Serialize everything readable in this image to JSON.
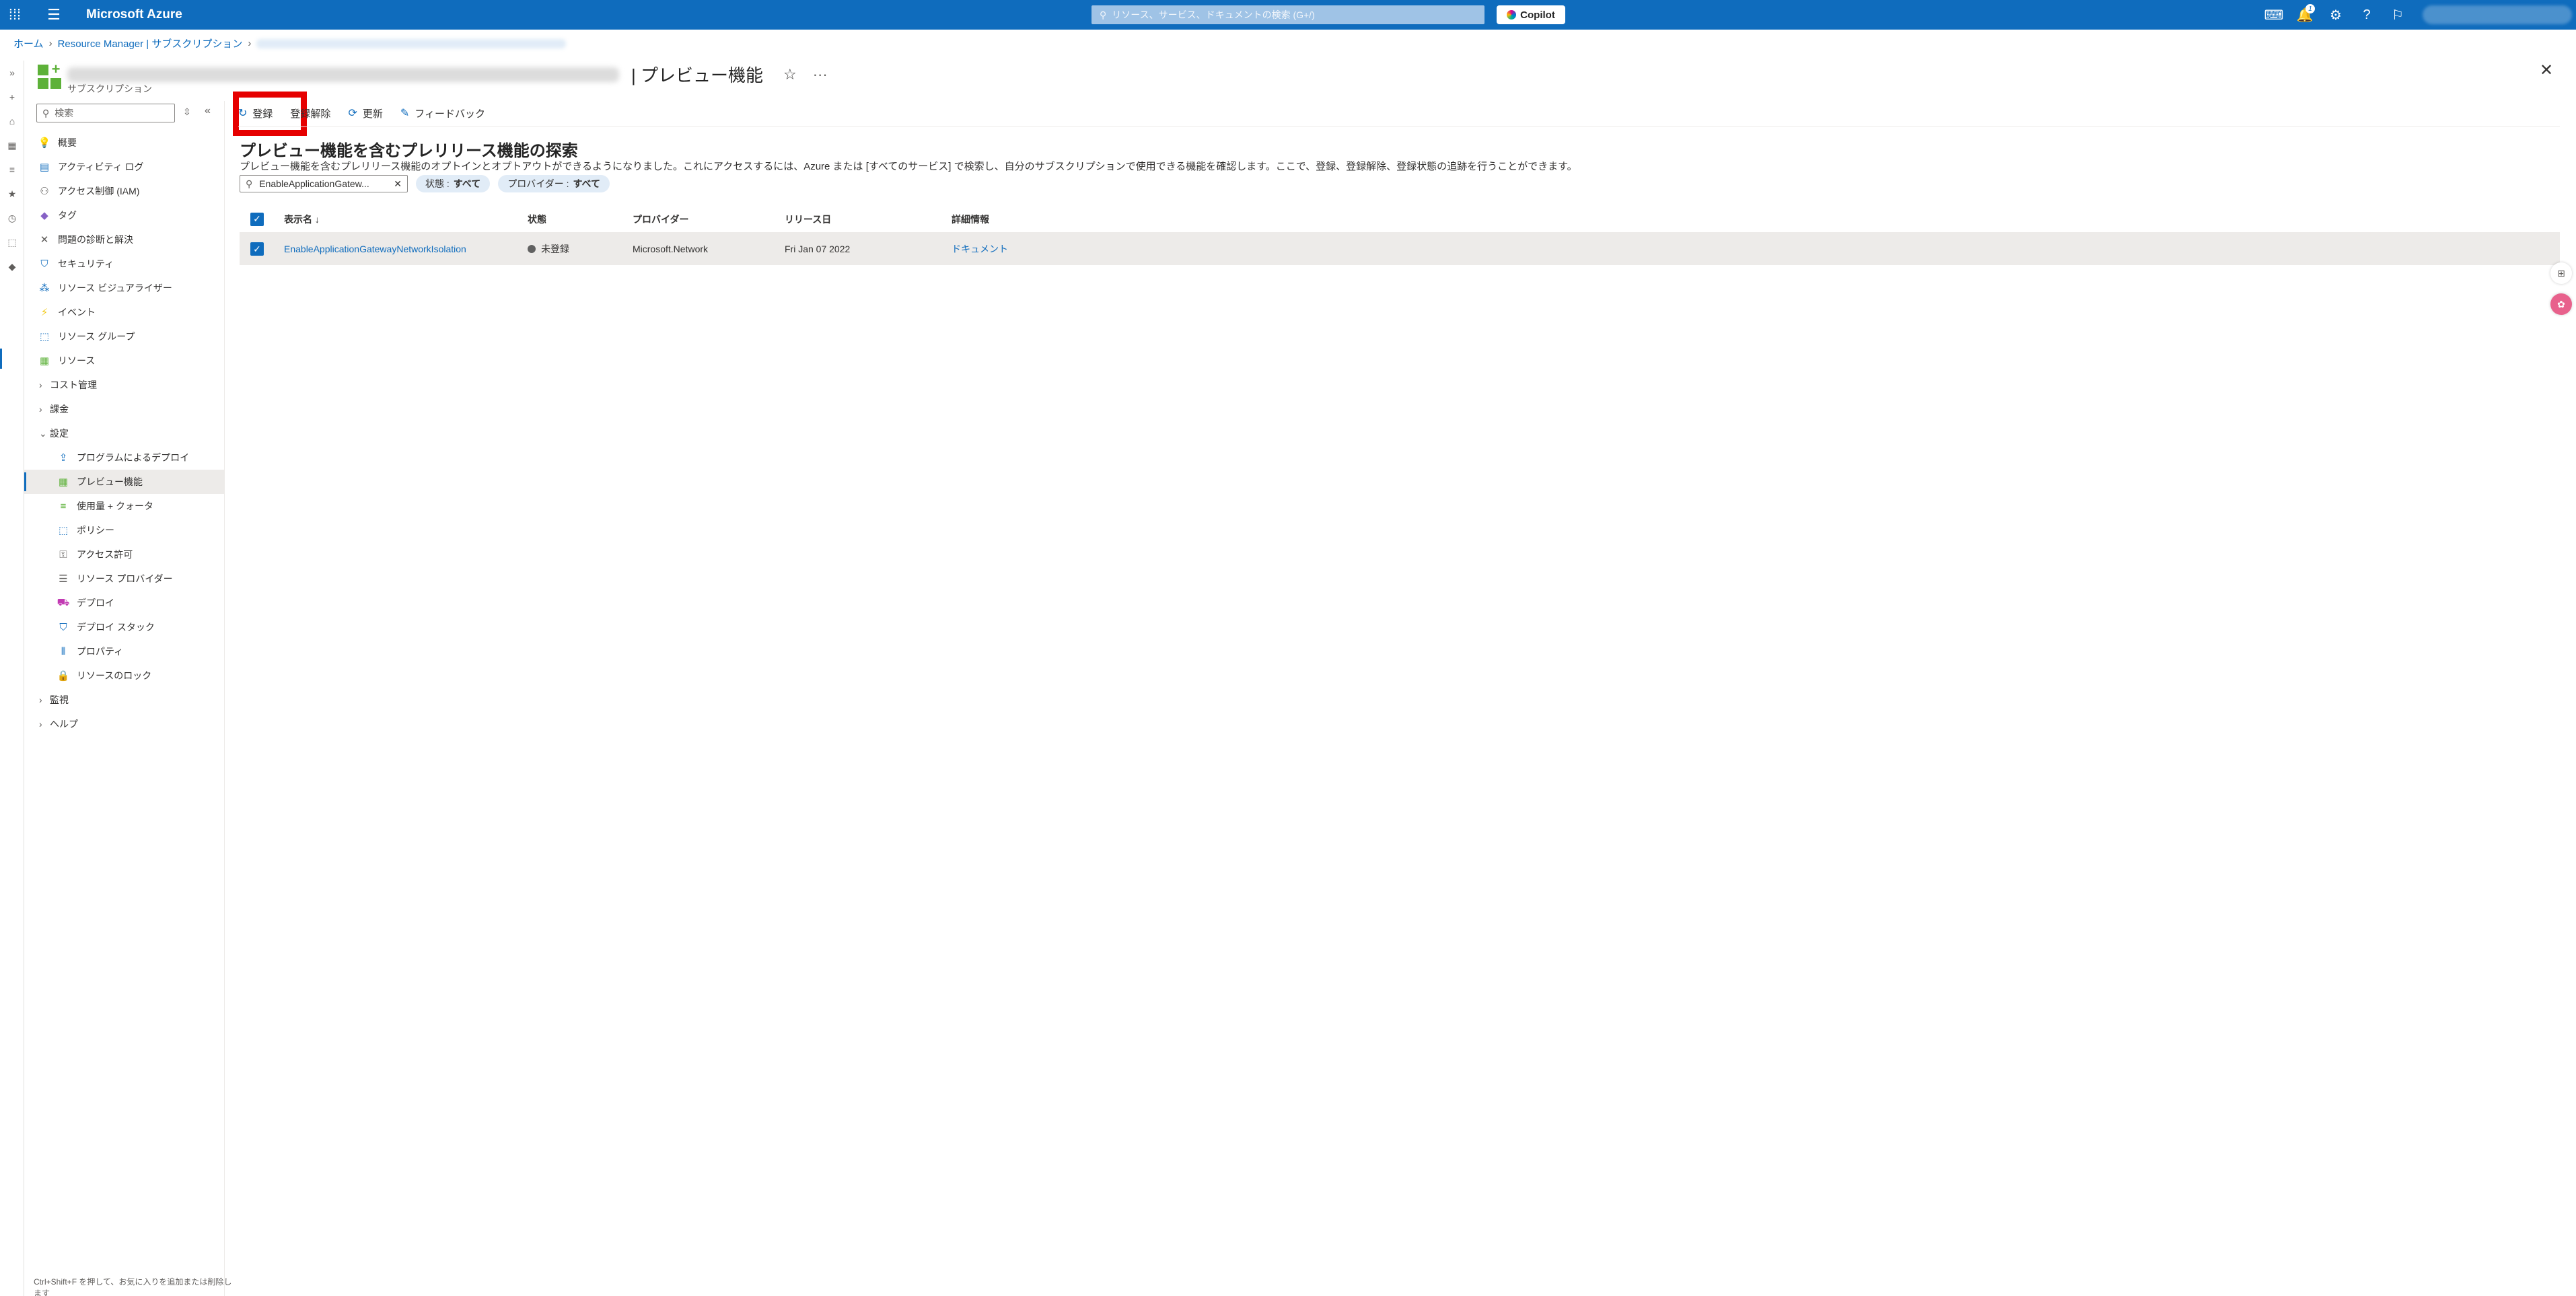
{
  "topbar": {
    "brand": "Microsoft Azure",
    "search_placeholder": "リソース、サービス、ドキュメントの検索 (G+/)",
    "copilot_label": "Copilot",
    "notification_count": "1"
  },
  "breadcrumb": {
    "home": "ホーム",
    "resource_manager": "Resource Manager | サブスクリプション"
  },
  "resource": {
    "title_suffix": "| プレビュー機能",
    "subtitle": "サブスクリプション"
  },
  "sidenav": {
    "search_placeholder": "検索",
    "items": [
      {
        "label": "概要",
        "icon": "lightbulb-icon",
        "level": 1
      },
      {
        "label": "アクティビティ ログ",
        "icon": "activity-log-icon",
        "level": 1
      },
      {
        "label": "アクセス制御 (IAM)",
        "icon": "iam-icon",
        "level": 1
      },
      {
        "label": "タグ",
        "icon": "tag-icon",
        "level": 1
      },
      {
        "label": "問題の診断と解決",
        "icon": "wrench-icon",
        "level": 1
      },
      {
        "label": "セキュリティ",
        "icon": "shield-icon",
        "level": 1
      },
      {
        "label": "リソース ビジュアライザー",
        "icon": "visualizer-icon",
        "level": 1
      },
      {
        "label": "イベント",
        "icon": "lightning-icon",
        "level": 1
      },
      {
        "label": "リソース グループ",
        "icon": "resource-group-icon",
        "level": 1
      },
      {
        "label": "リソース",
        "icon": "grid-icon",
        "level": 1
      },
      {
        "label": "コスト管理",
        "icon": "chevron-right-icon",
        "level": 1,
        "group": true
      },
      {
        "label": "課金",
        "icon": "chevron-right-icon",
        "level": 1,
        "group": true
      },
      {
        "label": "設定",
        "icon": "chevron-down-icon",
        "level": 1,
        "group": true
      },
      {
        "label": "プログラムによるデプロイ",
        "icon": "deploy-icon",
        "level": 2
      },
      {
        "label": "プレビュー機能",
        "icon": "preview-icon",
        "level": 2,
        "selected": true
      },
      {
        "label": "使用量 + クォータ",
        "icon": "usage-icon",
        "level": 2
      },
      {
        "label": "ポリシー",
        "icon": "policy-icon",
        "level": 2
      },
      {
        "label": "アクセス許可",
        "icon": "permission-icon",
        "level": 2
      },
      {
        "label": "リソース プロバイダー",
        "icon": "list-icon",
        "level": 2
      },
      {
        "label": "デプロイ",
        "icon": "deployment-icon",
        "level": 2
      },
      {
        "label": "デプロイ スタック",
        "icon": "stack-icon",
        "level": 2
      },
      {
        "label": "プロパティ",
        "icon": "properties-icon",
        "level": 2
      },
      {
        "label": "リソースのロック",
        "icon": "lock-icon",
        "level": 2
      },
      {
        "label": "監視",
        "icon": "chevron-right-icon",
        "level": 1,
        "group": true
      },
      {
        "label": "ヘルプ",
        "icon": "chevron-right-icon",
        "level": 1,
        "group": true
      }
    ],
    "footer": "Ctrl+Shift+F を押して、お気に入りを追加または削除します"
  },
  "commands": {
    "register": "登録",
    "unregister": "登録解除",
    "refresh": "更新",
    "feedback": "フィードバック"
  },
  "content": {
    "heading": "プレビュー機能を含むプレリリース機能の探索",
    "description": "プレビュー機能を含むプレリリース機能のオプトインとオプトアウトができるようになりました。これにアクセスするには、Azure または [すべてのサービス] で検索し、自分のサブスクリプションで使用できる機能を確認します。ここで、登録、登録解除、登録状態の追跡を行うことができます。",
    "filter_value": "EnableApplicationGatew...",
    "state_filter_label": "状態 :",
    "state_filter_value": "すべて",
    "provider_filter_label": "プロバイダー :",
    "provider_filter_value": "すべて"
  },
  "table": {
    "headers": {
      "name": "表示名 ↓",
      "state": "状態",
      "provider": "プロバイダー",
      "release_date": "リリース日",
      "details": "詳細情報"
    },
    "rows": [
      {
        "name": "EnableApplicationGatewayNetworkIsolation",
        "state": "未登録",
        "provider": "Microsoft.Network",
        "release_date": "Fri Jan 07 2022",
        "details": "ドキュメント"
      }
    ]
  },
  "colors": {
    "topbar": "#0f6cbd",
    "accent": "#0f6cbd",
    "highlight": "#e60000"
  }
}
